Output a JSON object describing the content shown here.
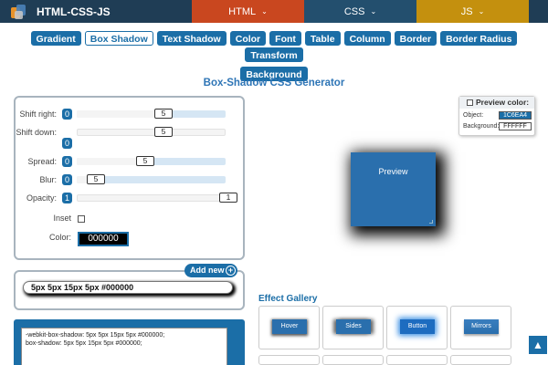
{
  "nav": {
    "brand": "HTML-CSS-JS",
    "tabs": [
      {
        "label": "HTML",
        "color": "#c9471f"
      },
      {
        "label": "CSS",
        "color": "#234f6e"
      },
      {
        "label": "JS",
        "color": "#c4900e"
      }
    ]
  },
  "tools": {
    "row1": [
      "Gradient",
      "Box Shadow",
      "Text Shadow",
      "Color",
      "Font",
      "Table",
      "Column",
      "Border",
      "Border Radius",
      "Transform"
    ],
    "row2": [
      "Background"
    ],
    "active": "Box Shadow"
  },
  "page_title": "Box-Shadow CSS Generator",
  "controls": {
    "shift_right": {
      "label": "Shift right:",
      "min": "0",
      "value": "5"
    },
    "shift_down": {
      "label": "Shift down:",
      "min": "0",
      "value": "5"
    },
    "spread": {
      "label": "Spread:",
      "min": "0",
      "value": "5"
    },
    "blur": {
      "label": "Blur:",
      "min": "0",
      "value": "5"
    },
    "opacity": {
      "label": "Opacity:",
      "min": "1",
      "value": "1"
    },
    "inset": {
      "label": "Inset"
    },
    "color": {
      "label": "Color:",
      "value": "000000"
    }
  },
  "preview_color": {
    "heading": "Preview color:",
    "object_label": "Object:",
    "object_value": "1C6EA4",
    "background_label": "Background:",
    "background_value": "FFFFFF"
  },
  "preview": {
    "label": "Preview"
  },
  "output": {
    "add_new": "Add new",
    "value": "5px 5px 15px 5px #000000"
  },
  "code": {
    "line1": "-webkit-box-shadow: 5px 5px 15px 5px #000000;",
    "line2": "box-shadow: 5px 5px 15px 5px #000000;"
  },
  "gallery": {
    "title": "Effect Gallery",
    "items": [
      "Hover",
      "Sides",
      "Button",
      "Mirrors"
    ]
  }
}
